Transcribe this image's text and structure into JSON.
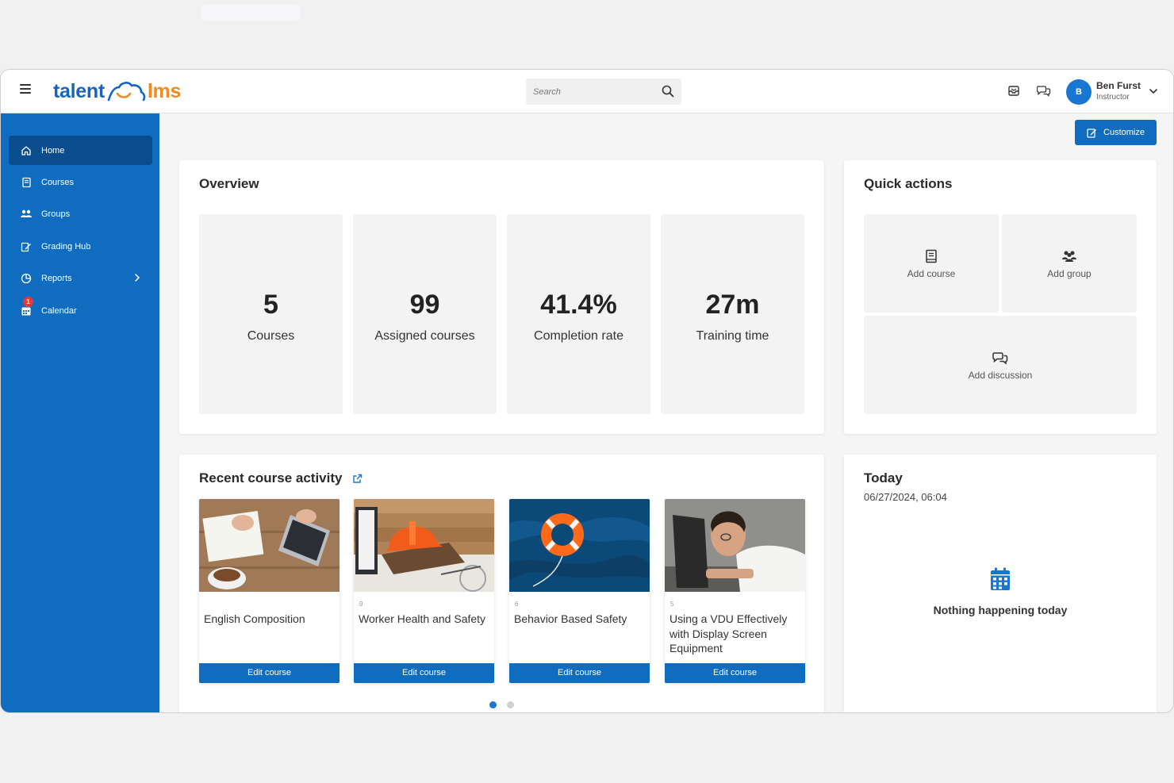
{
  "app": {
    "logo_left": "talent",
    "logo_right": "lms"
  },
  "header": {
    "search_placeholder": "Search",
    "user": {
      "initial": "B",
      "name": "Ben Furst",
      "role": "Instructor"
    }
  },
  "sidebar": {
    "items": [
      {
        "label": "Home",
        "icon": "home-icon"
      },
      {
        "label": "Courses",
        "icon": "book-icon"
      },
      {
        "label": "Groups",
        "icon": "users-icon"
      },
      {
        "label": "Grading Hub",
        "icon": "grading-icon"
      },
      {
        "label": "Reports",
        "icon": "chart-icon"
      },
      {
        "label": "Calendar",
        "icon": "calendar-icon",
        "badge": "1"
      }
    ]
  },
  "main": {
    "customize_label": "Customize",
    "overview": {
      "title": "Overview",
      "stats": [
        {
          "value": "5",
          "label": "Courses"
        },
        {
          "value": "99",
          "label": "Assigned courses"
        },
        {
          "value": "41.4%",
          "label": "Completion rate"
        },
        {
          "value": "27m",
          "label": "Training time"
        }
      ]
    },
    "quick_actions": {
      "title": "Quick actions",
      "items": [
        {
          "label": "Add course",
          "icon": "add-course-icon"
        },
        {
          "label": "Add group",
          "icon": "add-group-icon"
        },
        {
          "label": "Add discussion",
          "icon": "discussion-icon"
        }
      ]
    },
    "recent": {
      "title": "Recent course activity",
      "courses": [
        {
          "count": "",
          "title": "English Composition",
          "button": "Edit course"
        },
        {
          "count": "9",
          "title": "Worker Health and Safety",
          "button": "Edit course"
        },
        {
          "count": "6",
          "title": "Behavior Based Safety",
          "button": "Edit course"
        },
        {
          "count": "5",
          "title": "Using a VDU Effectively with Display Screen Equipment",
          "button": "Edit course"
        }
      ]
    },
    "today": {
      "title": "Today",
      "datetime": "06/27/2024, 06:04",
      "empty_message": "Nothing happening today"
    }
  },
  "colors": {
    "primary": "#0f6cbf",
    "sidebar_active": "#0a4d8f",
    "accent_orange": "#f08a24",
    "badge": "#e53935"
  }
}
